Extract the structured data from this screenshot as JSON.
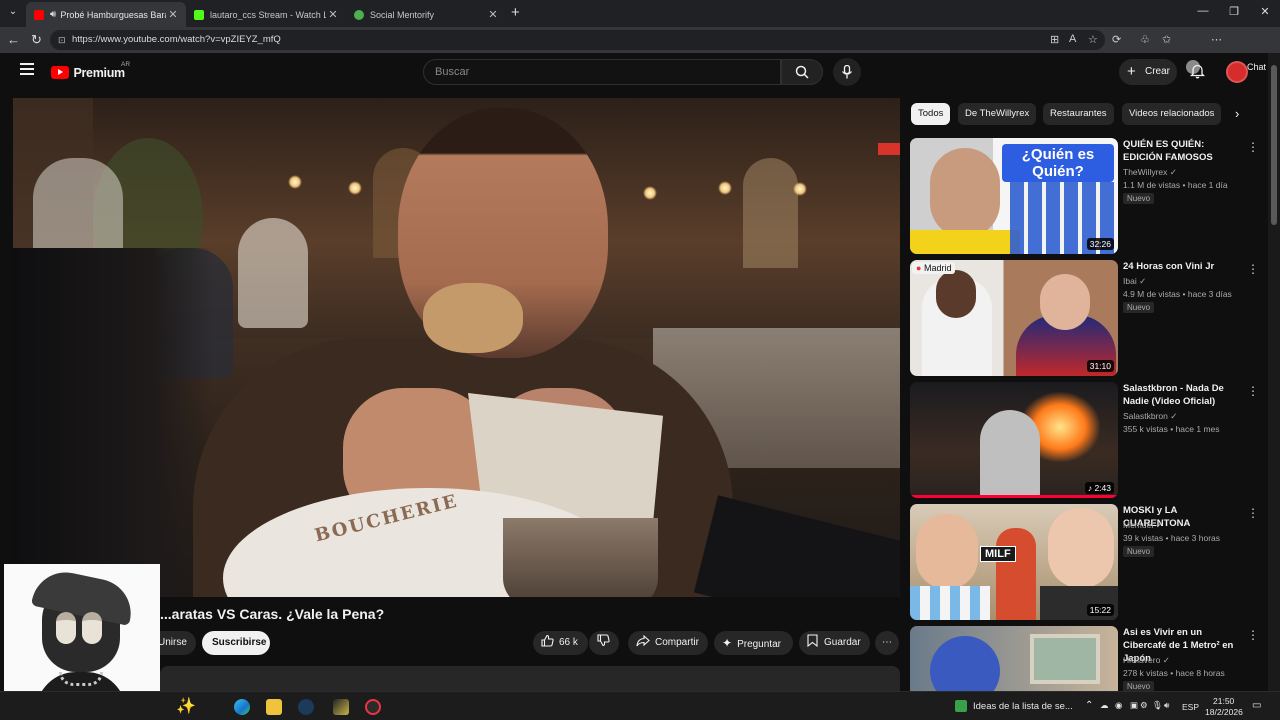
{
  "browser": {
    "tabs": [
      {
        "title": "Probé Hamburguesas Baratas VS Caras",
        "active": true
      },
      {
        "title": "lautaro_ccs Stream - Watch Live o",
        "active": false
      },
      {
        "title": "Social Mentorify",
        "active": false
      }
    ],
    "url": "https://www.youtube.com/watch?v=vpZIEYZ_mfQ",
    "chat_label": "Chat"
  },
  "youtube": {
    "logo_text": "Premium",
    "logo_region": "AR",
    "search_placeholder": "Buscar",
    "create_label": "Crear",
    "video_title": "...aratas VS Caras. ¿Vale la Pena?",
    "video_watermark": "BOUCHERIE",
    "join_label": "Unirse",
    "subscribe_label": "Suscribirse",
    "likes": "66 k",
    "share_label": "Compartir",
    "ask_label": "Preguntar",
    "save_label": "Guardar"
  },
  "chips": [
    "Todos",
    "De TheWillyrex",
    "Restaurantes",
    "Videos relacionados"
  ],
  "recommendations": [
    {
      "title": "QUIÉN ES QUIÉN: EDICIÓN FAMOSOS",
      "channel": "TheWillyrex",
      "meta": "1.1 M de vistas • hace 1 día",
      "badge": "Nuevo",
      "duration": "32:26",
      "thumb_text": "¿Quién es Quién?"
    },
    {
      "title": "24 Horas con Vini Jr",
      "channel": "Ibai",
      "meta": "4.9 M de vistas • hace 3 días",
      "badge": "Nuevo",
      "duration": "31:10",
      "thumb_text": "Madrid"
    },
    {
      "title": "Salastkbron - Nada De Nadie (Video Oficial)",
      "channel": "Salastkbron",
      "meta": "355 k vistas • hace 1 mes",
      "badge": "",
      "duration": "2:43",
      "thumb_text": ""
    },
    {
      "title": "MOSKI y LA CUARENTONA",
      "channel": "Memuel",
      "meta": "39 k vistas • hace 3 horas",
      "badge": "Nuevo",
      "duration": "15:22",
      "thumb_text": "MILF"
    },
    {
      "title": "Asi es Vivir en un Cibercafé de 1 Metro² en Japón",
      "channel": "HiClavero",
      "meta": "278 k vistas • hace 8 horas",
      "badge": "Nuevo",
      "duration": "",
      "thumb_text": ""
    }
  ],
  "taskbar": {
    "widget_text": "Ideas de la lista de se...",
    "lang": "ESP",
    "time": "21:50",
    "date": "18/2/2026"
  }
}
